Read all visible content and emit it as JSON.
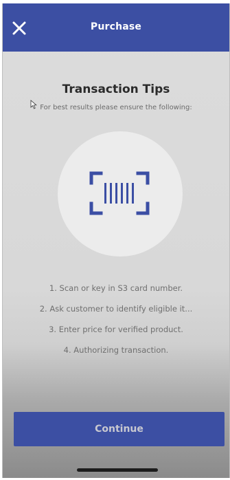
{
  "header": {
    "title": "Purchase",
    "close_icon": "close-icon",
    "background_color": "#3c4fa3"
  },
  "tips": {
    "title": "Transaction Tips",
    "subtitle": "For best results please ensure the following:",
    "illustration_icon": "barcode-scan-icon",
    "steps": [
      "1. Scan or key in S3 card number.",
      "2. Ask customer to identify eligible it...",
      "3. Enter price for verified product.",
      "4. Authorizing transaction."
    ]
  },
  "footer": {
    "continue_label": "Continue"
  },
  "colors": {
    "accent": "#3c4fa3"
  }
}
